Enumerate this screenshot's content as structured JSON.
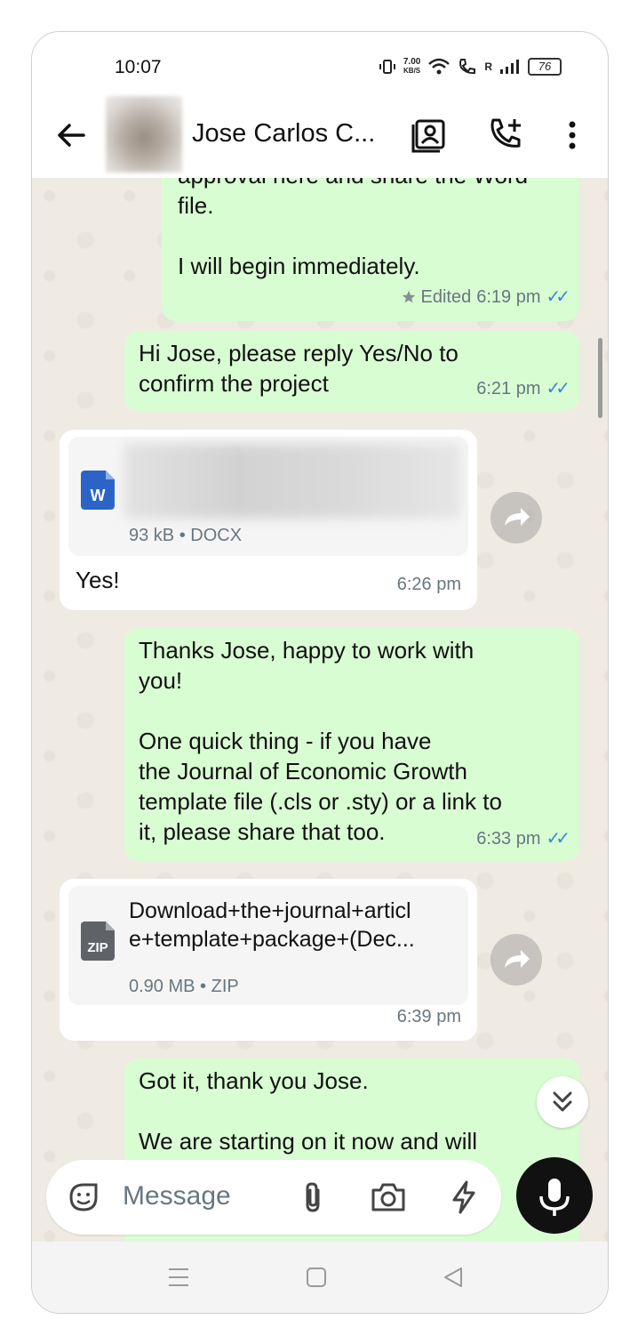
{
  "status_bar": {
    "time": "10:07",
    "net_speed_value": "7.00",
    "net_speed_unit": "KB/S",
    "roaming": "R",
    "battery": "76"
  },
  "header": {
    "contact_name": "Jose Carlos C..."
  },
  "messages": [
    {
      "direction": "outgoing",
      "text_partial": "approval here and share the Word",
      "text": "file.\n\nI will begin immediately.",
      "edited_label": "Edited",
      "time": "6:19 pm",
      "starred": true
    },
    {
      "direction": "outgoing",
      "text": "Hi Jose, please reply Yes/No to\nconfirm the project",
      "time": "6:21 pm"
    },
    {
      "direction": "incoming",
      "attachment": {
        "icon_letter": "W",
        "meta": "93 kB • DOCX",
        "name_blurred": true
      },
      "text": "Yes!",
      "time": "6:26 pm"
    },
    {
      "direction": "outgoing",
      "text": "Thanks Jose, happy to work with\nyou!\n\nOne quick thing -  if you have\nthe Journal of Economic Growth\ntemplate file (.cls or .sty) or a link to\nit, please share that too.",
      "time": "6:33 pm"
    },
    {
      "direction": "incoming",
      "attachment": {
        "icon_letter": "ZIP",
        "name": "Download+the+journal+articl\ne+template+package+(Dec...",
        "meta": "0.90 MB • ZIP"
      },
      "time": "6:39 pm"
    },
    {
      "direction": "outgoing",
      "text": "Got it, thank you Jose.\n\nWe are starting on it now and will"
    }
  ],
  "composer": {
    "placeholder": "Message"
  },
  "colors": {
    "outgoing_bubble": "#d9fdd3",
    "incoming_bubble": "#ffffff",
    "chat_background": "#efeae2",
    "read_ticks": "#3a86d8",
    "word_icon": "#2b64c6",
    "zip_icon": "#5f6368"
  },
  "icons": [
    "back-arrow-icon",
    "contact-card-icon",
    "add-call-icon",
    "more-vert-icon",
    "star-icon",
    "double-check-icon",
    "word-doc-icon",
    "zip-file-icon",
    "forward-icon",
    "chevron-double-down-icon",
    "sticker-icon",
    "attach-icon",
    "camera-icon",
    "bolt-icon",
    "mic-icon",
    "nav-menu-icon",
    "nav-home-icon",
    "nav-back-icon"
  ]
}
